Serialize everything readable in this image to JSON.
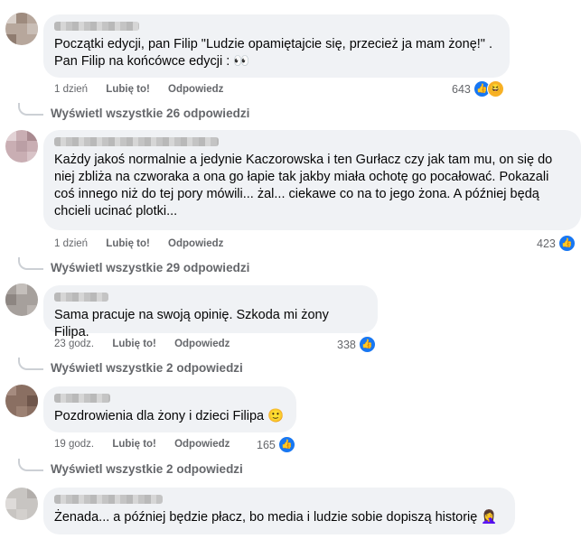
{
  "comments": [
    {
      "text": "Początki edycji, pan Filip \"Ludzie opamiętajcie się, przecież ja mam żonę!\" . Pan Filip na końcówce edycji : 👀",
      "time": "1 dzień",
      "like": "Lubię to!",
      "reply": "Odpowiedz",
      "count": "643",
      "replies": "Wyświetl wszystkie 26 odpowiedzi"
    },
    {
      "text": "Każdy jakoś normalnie a jedynie Kaczorowska i ten Gurłacz czy jak tam mu, on się do niej zbliża na czworaka a ona go łapie tak jakby miała ochotę go pocałować. Pokazali coś innego niż do tej pory mówili... żal... ciekawe co na to jego żona. A później będą chcieli ucinać plotki...",
      "time": "1 dzień",
      "like": "Lubię to!",
      "reply": "Odpowiedz",
      "count": "423",
      "replies": "Wyświetl wszystkie 29 odpowiedzi"
    },
    {
      "text": "Sama pracuje na swoją opinię. Szkoda mi żony Filipa.",
      "time": "23 godz.",
      "like": "Lubię to!",
      "reply": "Odpowiedz",
      "count": "338",
      "replies": "Wyświetl wszystkie 2 odpowiedzi"
    },
    {
      "text": "Pozdrowienia dla żony i dzieci Filipa 🙂",
      "time": "19 godz.",
      "like": "Lubię to!",
      "reply": "Odpowiedz",
      "count": "165",
      "replies": "Wyświetl wszystkie 2 odpowiedzi"
    },
    {
      "text": "Żenada... a później będzie płacz, bo media i ludzie sobie dopiszą historię 🤦‍♀️"
    }
  ],
  "icons": {
    "like": "like-reaction-icon",
    "haha": "haha-reaction-icon"
  },
  "colors": {
    "accent": "#1877f2",
    "bubble": "#f0f2f5",
    "meta": "#65676b"
  }
}
